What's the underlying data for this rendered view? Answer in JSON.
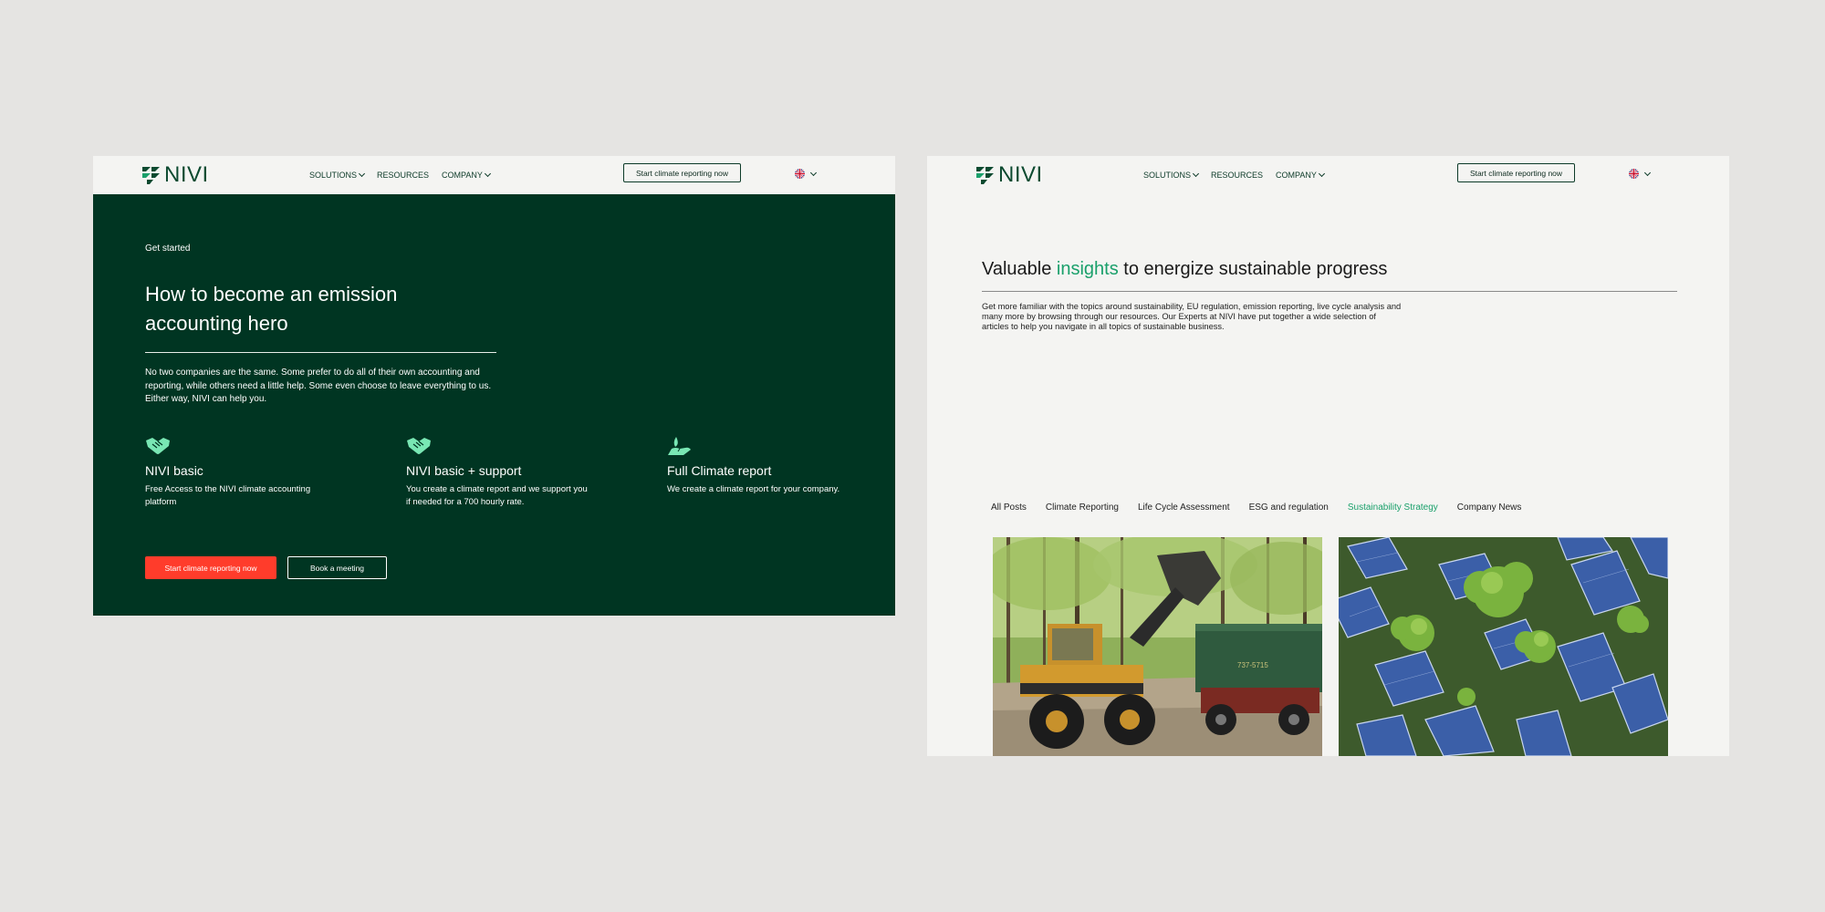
{
  "left_page": {
    "brand": {
      "logo_text": "NIVI"
    },
    "nav": {
      "items": [
        {
          "label": "SOLUTIONS",
          "has_dropdown": true
        },
        {
          "label": "RESOURCES",
          "has_dropdown": false
        },
        {
          "label": "COMPANY",
          "has_dropdown": true
        }
      ],
      "cta_label": "Start climate reporting now",
      "language_icon": "uk-flag-icon"
    },
    "hero": {
      "eyebrow": "Get started",
      "title": "How to become an emission accounting hero",
      "description": "No two companies are the same. Some prefer to do all of their own accounting and reporting, while others need a little help. Some even choose to leave everything to us. Either way, NIVI can help you."
    },
    "offers": [
      {
        "icon": "handshake-icon",
        "title": "NIVI basic",
        "description": "Free Access to the NIVI climate accounting platform"
      },
      {
        "icon": "handshake-icon",
        "title": "NIVI basic + support",
        "description": "You create a climate report and we support you if needed for a 700 hourly rate."
      },
      {
        "icon": "hand-leaf-icon",
        "title": "Full Climate report",
        "description": "We create a climate report for your company."
      }
    ],
    "buttons": {
      "primary": "Start climate reporting now",
      "secondary": "Book a meeting"
    }
  },
  "right_page": {
    "brand": {
      "logo_text": "NIVI"
    },
    "nav": {
      "items": [
        {
          "label": "SOLUTIONS",
          "has_dropdown": true
        },
        {
          "label": "RESOURCES",
          "has_dropdown": false
        },
        {
          "label": "COMPANY",
          "has_dropdown": true
        }
      ],
      "cta_label": "Start climate reporting now",
      "language_icon": "uk-flag-icon"
    },
    "insights": {
      "title_prefix": "Valuable ",
      "title_accent": "insights",
      "title_suffix": " to energize sustainable progress",
      "description": "Get more familiar with the topics around sustainability, EU regulation, emission reporting, live cycle analysis and many more by browsing through our resources. Our Experts at NIVI have put together a wide selection of articles to help you navigate in all topics of sustainable business."
    },
    "filters": [
      "All Posts",
      "Climate Reporting",
      "Life Cycle Assessment",
      "ESG and regulation",
      "Sustainability Strategy",
      "Company News"
    ],
    "active_filter": "Sustainability Strategy",
    "cards": [
      {
        "image": "wheel-loader-and-dump-truck-photo",
        "truck_plate": "737-5715"
      },
      {
        "image": "solar-panels-with-trees-photo"
      }
    ]
  },
  "colors": {
    "page_background": "#e5e4e2",
    "hero_background": "#003522",
    "nav_background": "#f4f4f2",
    "accent_green": "#1aa06b",
    "icon_mint": "#79e7b4",
    "primary_button": "#ff3c2b"
  }
}
